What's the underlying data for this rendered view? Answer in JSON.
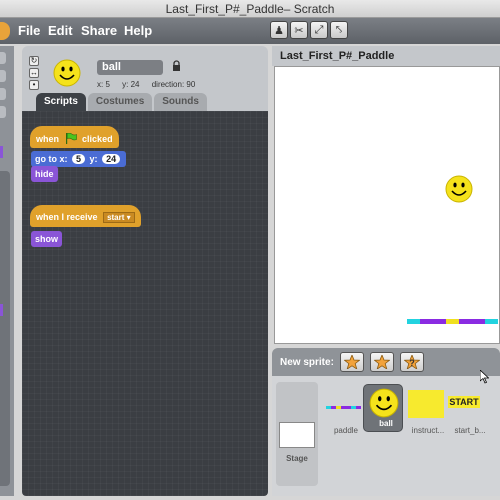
{
  "window": {
    "title": "Last_First_P#_Paddle– Scratch"
  },
  "menu": {
    "items": [
      "File",
      "Edit",
      "Share",
      "Help"
    ]
  },
  "toolbar": {
    "tools": [
      "duplicate-icon",
      "cut-icon",
      "grow-icon",
      "shrink-icon"
    ]
  },
  "sprite": {
    "name": "ball",
    "x_label": "x: 5",
    "y_label": "y: 24",
    "direction_label": "direction: 90"
  },
  "tabs": [
    "Scripts",
    "Costumes",
    "Sounds"
  ],
  "scripts": {
    "hat1": {
      "when": "when",
      "clicked": "clicked"
    },
    "goto": {
      "label_goto": "go to x:",
      "x": "5",
      "label_y": "y:",
      "y": "24"
    },
    "hide": "hide",
    "hat2": {
      "label": "when I receive",
      "message": "start"
    },
    "show": "show"
  },
  "stage": {
    "title": "Last_First_P#_Paddle"
  },
  "new_sprite": {
    "label": "New sprite:"
  },
  "library": {
    "stage_label": "Stage",
    "sprites": [
      {
        "label": "paddle"
      },
      {
        "label": "ball"
      },
      {
        "label": "instruct..."
      },
      {
        "label": "start_b..."
      }
    ],
    "start_text": "START"
  },
  "colors": {
    "hat_block": "#e0a12b",
    "motion_block": "#4a6cd4",
    "looks_block": "#8a55d7",
    "ball_yellow": "#f5e21b",
    "paddle_colors": [
      "#22d3e0",
      "#8a2be2",
      "#f0e020"
    ]
  }
}
